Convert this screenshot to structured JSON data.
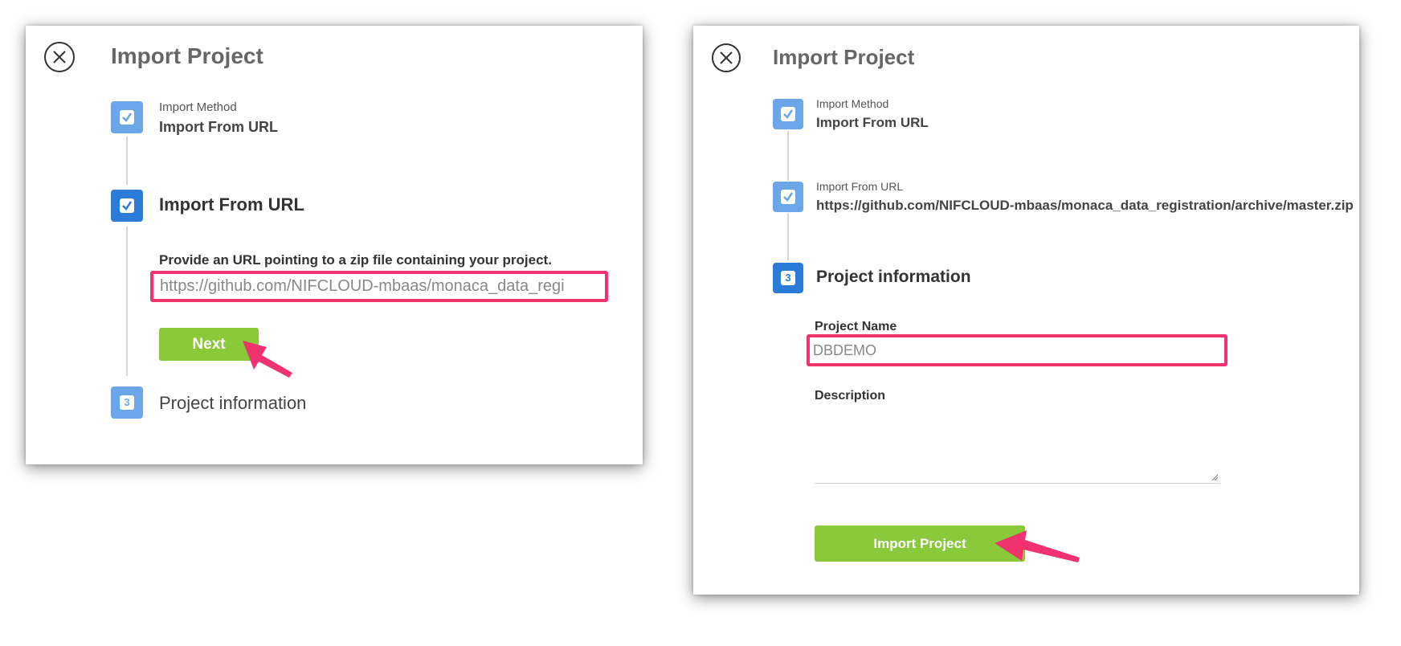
{
  "colors": {
    "accent_pink": "#f0336e",
    "button_green": "#8ac93a",
    "step_blue_light": "#6aa6e8",
    "step_blue_dark": "#2b7bd9"
  },
  "left_dialog": {
    "title": "Import Project",
    "close_icon": "close-circle-icon",
    "step1": {
      "label": "Import Method",
      "value": "Import From URL"
    },
    "step2": {
      "title": "Import From URL",
      "instruction": "Provide an URL pointing to a zip file containing your project.",
      "url_value": "https://github.com/NIFCLOUD-mbaas/monaca_data_regi"
    },
    "next_label": "Next",
    "step3": {
      "number": "3",
      "title": "Project information"
    }
  },
  "right_dialog": {
    "title": "Import Project",
    "close_icon": "close-circle-icon",
    "step1": {
      "label": "Import Method",
      "value": "Import From URL"
    },
    "step2": {
      "label": "Import From URL",
      "value": "https://github.com/NIFCLOUD-mbaas/monaca_data_registration/archive/master.zip"
    },
    "step3": {
      "number": "3",
      "title": "Project information"
    },
    "project_name_label": "Project Name",
    "project_name_value": "DBDEMO",
    "description_label": "Description",
    "import_label": "Import Project"
  }
}
